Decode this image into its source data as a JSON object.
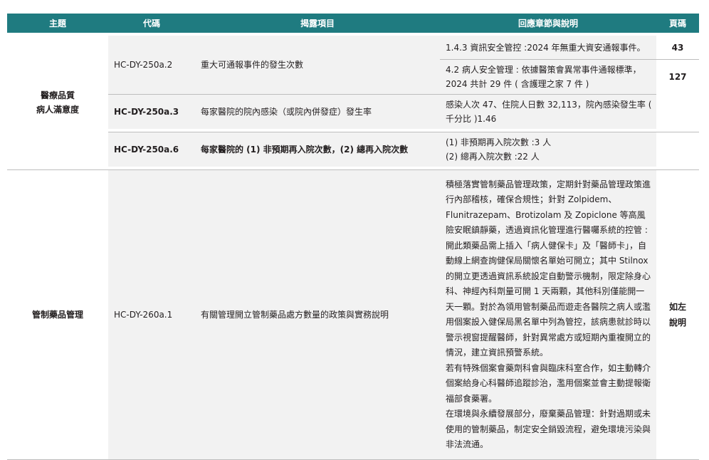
{
  "headers": [
    "主題",
    "代碼",
    "揭露項目",
    "回應章節與說明",
    "頁碼"
  ],
  "section1": {
    "topic": "醫療品質\n病人滿意度",
    "rows": [
      {
        "code": "HC-DY-250a.2",
        "item": "重大可通報事件的發生次數",
        "responses": [
          {
            "text": "1.4.3 資訊安全管控 :2024 年無重大資安通報事件。",
            "page": "43"
          },
          {
            "text": "4.2 病人安全管理 : 依據醫策會異常事件通報標準，2024 共計 29 件 ( 含護理之家 7 件 )",
            "page": "127"
          }
        ]
      },
      {
        "code": "HC-DY-250a.3",
        "item": "每家醫院的院內感染（或院內併發症）發生率",
        "response": "感染人次 47、住院人日數 32,113，院內感染發生率 ( 千分比 )1.46",
        "page": ""
      },
      {
        "code": "HC-DY-250a.6",
        "item": "每家醫院的 (1) 非預期再入院次數，(2) 總再入院次數",
        "response_lines": [
          "(1) 非預期再入院次數 :3 人",
          "(2) 總再入院次數 :22 人"
        ],
        "page": ""
      }
    ]
  },
  "section2": {
    "topic": "管制藥品管理",
    "code": "HC-DY-260a.1",
    "item": "有關管理開立管制藥品處方數量的政策與實務說明",
    "paragraphs": [
      "積極落實管制藥品管理政策，定期針對藥品管理政策進行內部稽核，確保合規性；針對 Zolpidem、Flunitrazepam、Brotizolam 及 Zopiclone 等高風險安眠鎮靜藥，透過資訊化管理進行醫囑系統的控管 : 開此類藥品需上插入「病人健保卡」及「醫師卡」，自動線上網查詢健保局關懷名單始可開立；其中 Stilnox 的開立更透過資訊系統設定自動警示機制，限定除身心科、神經內科劑量可開 1 天兩顆，其他科別僅能開一天一顆。對於為領用管制藥品而遊走各醫院之病人或濫用個案設入健保局黑名單中列為管控，該病患就診時以警示視窗提醒醫師，針對異常處方或短期內重複開立的情況，建立資訊預警系統。",
      "若有特殊個案會藥劑科會與臨床科室合作，如主動轉介個案給身心科醫師追蹤診治，濫用個案並會主動提報衛福部食藥署。",
      "在環境與永續發展部分，廢棄藥品管理：針對過期或未使用的管制藥品，制定安全銷毀流程，避免環境污染與非法流通。"
    ],
    "page": "如左\n說明"
  },
  "colors": {
    "header_bg": "#1f7b80",
    "cell_bg": "#f2f2f2",
    "rule": "#bdbdbd"
  }
}
